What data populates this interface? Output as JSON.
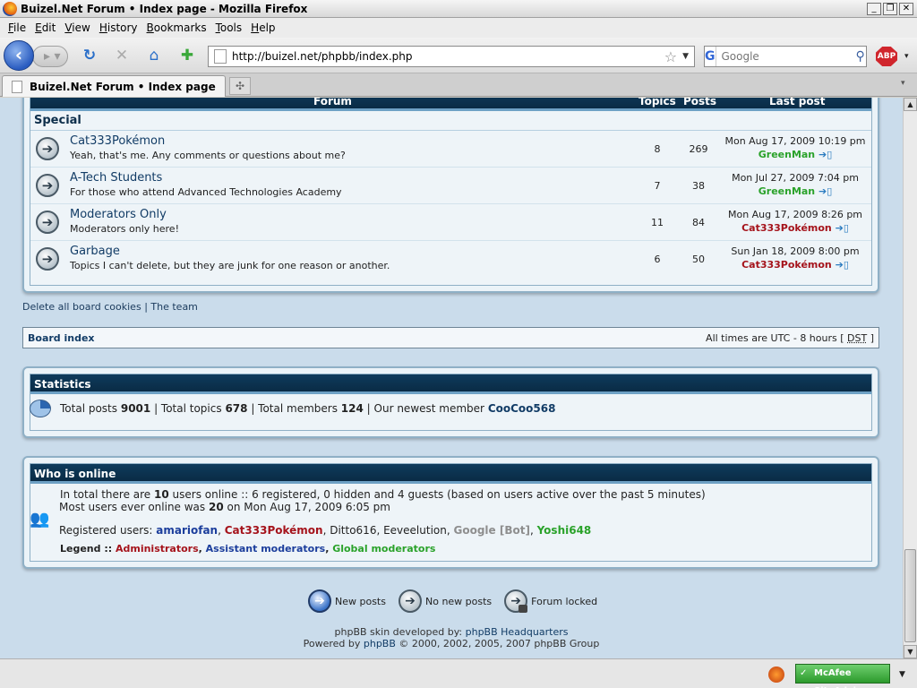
{
  "window": {
    "title": "Buizel.Net Forum • Index page - Mozilla Firefox"
  },
  "menu": {
    "items": [
      {
        "u": "F",
        "rest": "ile"
      },
      {
        "u": "E",
        "rest": "dit"
      },
      {
        "u": "V",
        "rest": "iew"
      },
      {
        "u": "H",
        "rest": "istory",
        "pre": ""
      },
      {
        "u": "B",
        "rest": "ookmarks"
      },
      {
        "u": "T",
        "rest": "ools"
      },
      {
        "u": "H",
        "rest": "elp"
      }
    ]
  },
  "nav": {
    "url": "http://buizel.net/phpbb/index.php",
    "search_placeholder": "Google",
    "abp_label": "ABP"
  },
  "tab": {
    "label": "Buizel.Net Forum • Index page"
  },
  "forum_header": {
    "forum": "Forum",
    "topics": "Topics",
    "posts": "Posts",
    "last_post": "Last post"
  },
  "category": "Special",
  "forums": [
    {
      "name": "Cat333Pokémon",
      "desc": "Yeah, that's me. Any comments or questions about me?",
      "topics": "8",
      "posts": "269",
      "last_date": "Mon Aug 17, 2009 10:19 pm",
      "last_user": "GreenMan",
      "user_color": "green"
    },
    {
      "name": "A-Tech Students",
      "desc": "For those who attend Advanced Technologies Academy",
      "topics": "7",
      "posts": "38",
      "last_date": "Mon Jul 27, 2009 7:04 pm",
      "last_user": "GreenMan",
      "user_color": "green"
    },
    {
      "name": "Moderators Only",
      "desc": "Moderators only here!",
      "topics": "11",
      "posts": "84",
      "last_date": "Mon Aug 17, 2009 8:26 pm",
      "last_user": "Cat333Pokémon",
      "user_color": "red"
    },
    {
      "name": "Garbage",
      "desc": "Topics I can't delete, but they are junk for one reason or another.",
      "topics": "6",
      "posts": "50",
      "last_date": "Sun Jan 18, 2009 8:00 pm",
      "last_user": "Cat333Pokémon",
      "user_color": "red"
    }
  ],
  "links": {
    "delete_cookies": "Delete all board cookies",
    "sep": "|",
    "team": "The team"
  },
  "boardbar": {
    "index": "Board index",
    "tz_prefix": "All times are UTC - 8 hours [",
    "dst": "DST",
    "tz_suffix": "]"
  },
  "stats": {
    "title": "Statistics",
    "posts_label": "Total posts",
    "posts": "9001",
    "topics_label": "Total topics",
    "topics": "678",
    "members_label": "Total members",
    "members": "124",
    "newest_label": "Our newest member",
    "newest": "CooCoo568"
  },
  "online": {
    "title": "Who is online",
    "total_prefix": "In total there are",
    "total": "10",
    "total_suffix": "users online :: 6 registered, 0 hidden and 4 guests (based on users active over the past 5 minutes)",
    "most_prefix": "Most users ever online was",
    "most": "20",
    "most_suffix": "on Mon Aug 17, 2009 6:05 pm",
    "registered_label": "Registered users:",
    "users": [
      {
        "name": "amariofan",
        "style": "blue"
      },
      {
        "name": "Cat333Pokémon",
        "style": "red"
      },
      {
        "name": "Ditto616",
        "style": "plain"
      },
      {
        "name": "Eeveelution",
        "style": "plain"
      },
      {
        "name": "Google [Bot]",
        "style": "grey"
      },
      {
        "name": "Yoshi648",
        "style": "green"
      }
    ],
    "legend_label": "Legend ::",
    "legend": [
      {
        "name": "Administrators",
        "style": "red"
      },
      {
        "name": "Assistant moderators",
        "style": "blue"
      },
      {
        "name": "Global moderators",
        "style": "green"
      }
    ]
  },
  "icon_legend": {
    "new_posts": "New posts",
    "no_new_posts": "No new posts",
    "forum_locked": "Forum locked"
  },
  "footer": {
    "line1_prefix": "phpBB skin developed by:",
    "line1_link": "phpBB Headquarters",
    "line2_prefix": "Powered by",
    "line2_link": "phpBB",
    "line2_suffix": "© 2000, 2002, 2005, 2007 phpBB Group"
  },
  "status": {
    "mcafee": "McAfee SiteAdvisor"
  },
  "colors": {
    "header": "#0e3b5c",
    "link": "#123c66",
    "green_user": "#2aa22a",
    "red_user": "#a5131b",
    "blue_user": "#1c3e9c"
  }
}
